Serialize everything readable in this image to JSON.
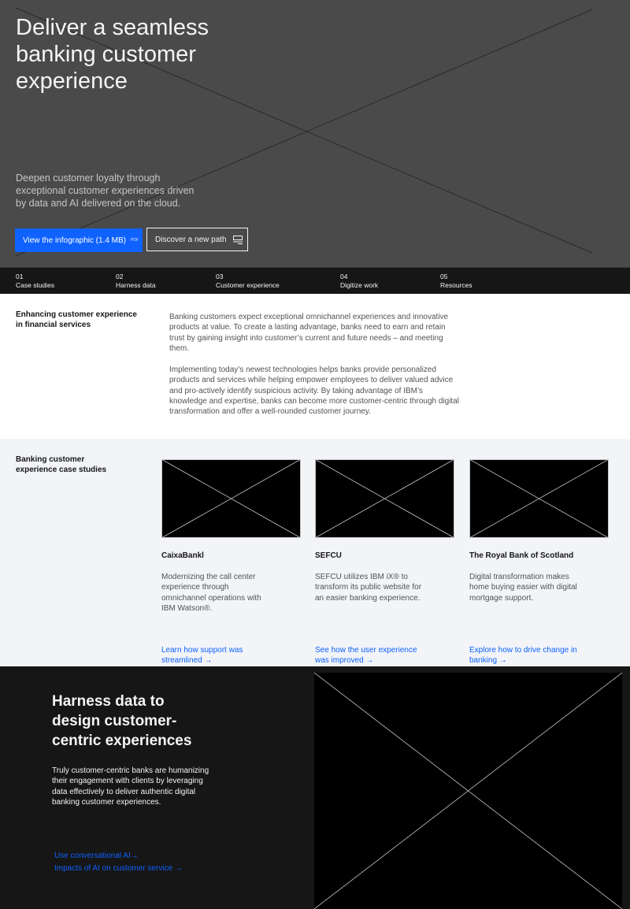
{
  "hero": {
    "title": "Deliver a seamless banking customer experience",
    "subtitle": "Deepen customer loyalty through exceptional customer experiences driven by data and AI delivered on the cloud.",
    "primary_button": "View the infographic (1.4 MB)",
    "primary_button_tag": "PDF",
    "secondary_button": "Discover a new path",
    "colors": {
      "background": "#4a4a4a",
      "primary": "#0f62fe"
    }
  },
  "tabs": [
    {
      "num": "01",
      "label": "Case studies"
    },
    {
      "num": "02",
      "label": "Harness data"
    },
    {
      "num": "03",
      "label": "Customer experience"
    },
    {
      "num": "04",
      "label": "Digitize work"
    },
    {
      "num": "05",
      "label": "Resources"
    }
  ],
  "intro": {
    "heading": "Enhancing customer experience in financial services",
    "paragraph1": "Banking customers expect exceptional omnichannel experiences and innovative products at value. To create a lasting advantage, banks need to earn and retain trust by gaining insight into customer’s current and future needs – and meeting them.",
    "paragraph2": "Implementing today’s newest technologies helps banks provide personalized products and services while helping empower employees to deliver valued advice and pro-actively identify suspicious activity. By taking advantage of IBM’s knowledge and expertise, banks can become more customer-centric through digital transformation and offer a well-rounded customer journey."
  },
  "cases": {
    "heading": "Banking customer experience case studies",
    "cards": [
      {
        "title": "CaixaBankl",
        "desc": "Modernizing the call center experience through omnichannel operations with IBM Watson®.",
        "link": "Learn how support was streamlined"
      },
      {
        "title": "SEFCU",
        "desc": "SEFCU utilizes IBM iX® to transform its public website for an easier banking experience.",
        "link": "See how the user experience was improved"
      },
      {
        "title": "The Royal Bank of Scotland",
        "desc": "Digital transformation makes home buying easier with digital mortgage support.",
        "link": "Explore how to drive change in banking"
      }
    ]
  },
  "harness": {
    "title": "Harness data to design customer-centric experiences",
    "body": "Truly customer-centric banks are humanizing their engagement with clients by leveraging data effectively to deliver authentic digital banking customer experiences.",
    "links": [
      "Use conversational AI",
      "Impacts of AI on customer service"
    ]
  }
}
